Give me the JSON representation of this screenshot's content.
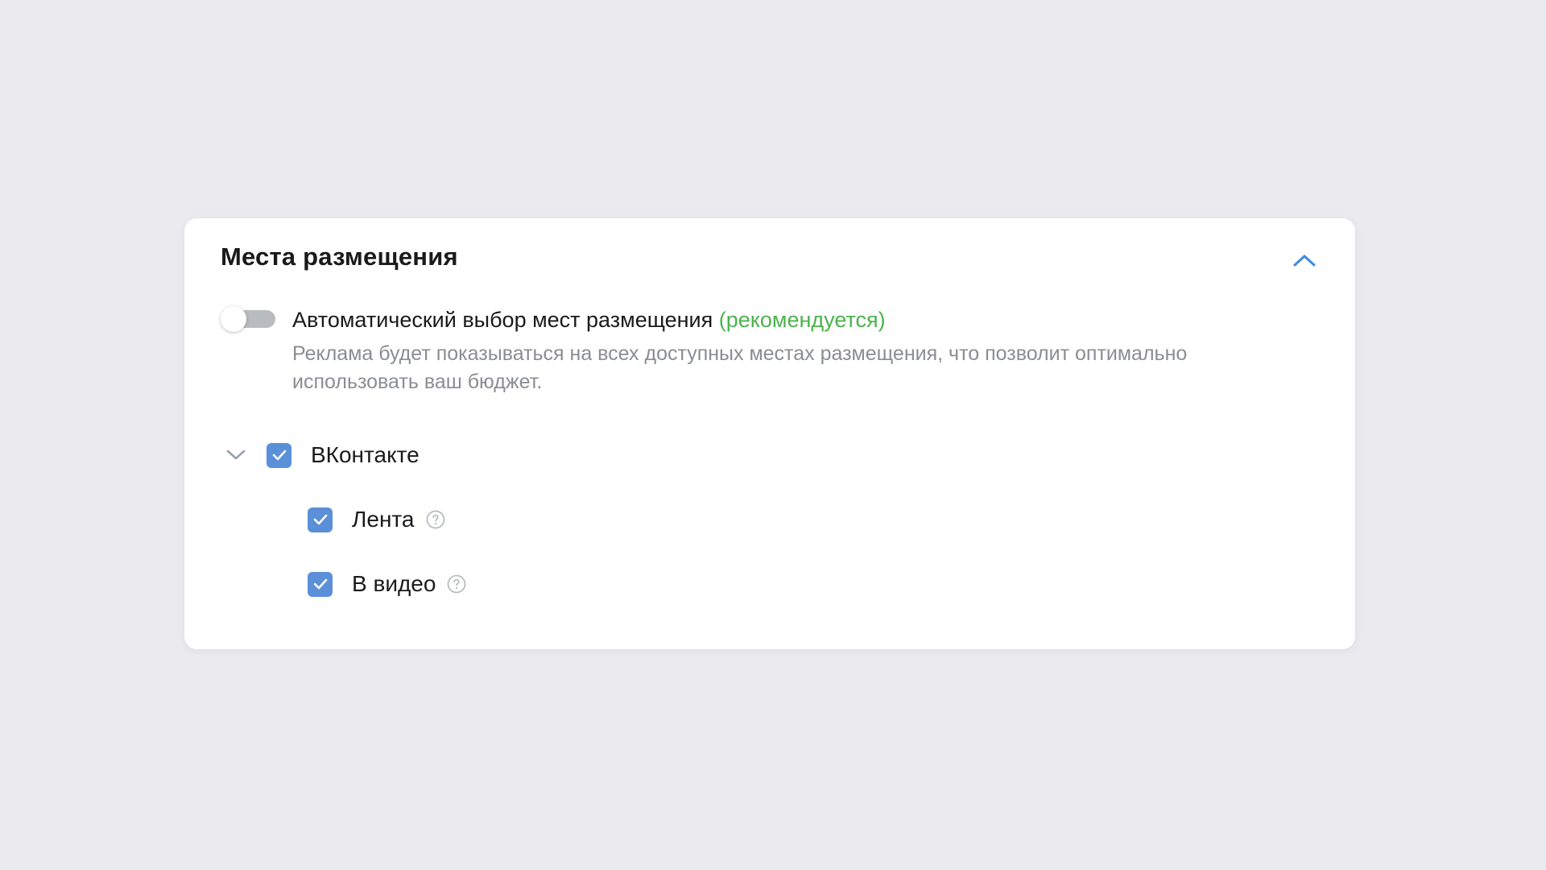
{
  "card": {
    "title": "Места размещения",
    "collapse_icon": "chevron-up-icon"
  },
  "auto_placement": {
    "toggle_state": "off",
    "label": "Автоматический выбор мест размещения",
    "recommended": "(рекомендуется)",
    "description": "Реклама будет показываться на всех доступных местах размещения, что позволит оптимально использовать ваш бюджет."
  },
  "platforms": [
    {
      "label": "ВКонтакте",
      "checked": true,
      "expanded": true,
      "children": [
        {
          "label": "Лента",
          "checked": true,
          "help_icon": "question-circle-icon"
        },
        {
          "label": "В видео",
          "checked": true,
          "help_icon": "question-circle-icon"
        }
      ]
    }
  ],
  "colors": {
    "page_background": "#ebebef",
    "card_background": "#ffffff",
    "accent_blue": "#5b8fd8",
    "recommended_green": "#4bb34b",
    "secondary_text": "#8a8d92",
    "toggle_off": "#b8bcc1"
  }
}
